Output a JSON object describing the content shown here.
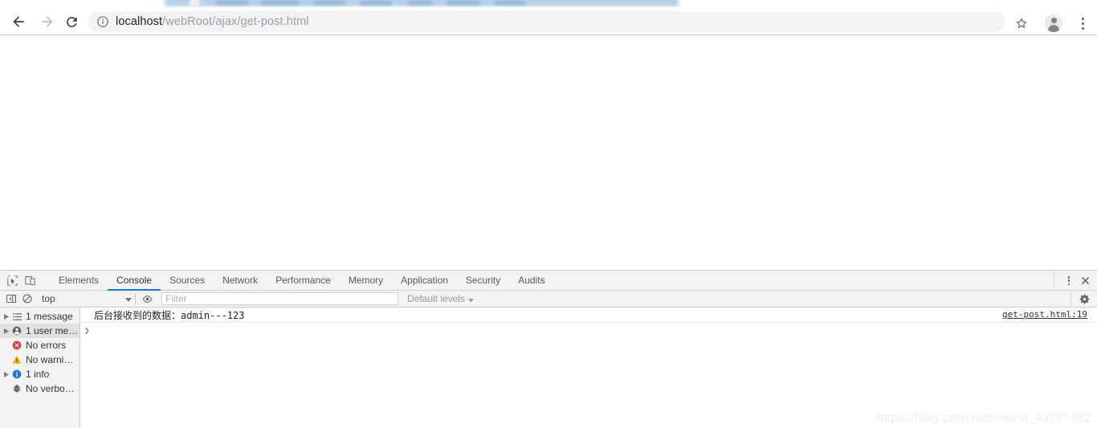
{
  "browser": {
    "nav": {
      "back_label": "Back",
      "forward_label": "Forward",
      "reload_label": "Reload"
    },
    "omnibox": {
      "host": "localhost",
      "path": "/webRoot/ajax/get-post.html",
      "full_url": "localhost/webRoot/ajax/get-post.html",
      "security_icon": "info-circle-icon"
    },
    "actions": {
      "bookmark_label": "Bookmark this page",
      "profile_label": "Profile",
      "menu_label": "Customize and control Google Chrome"
    }
  },
  "devtools": {
    "tools": {
      "inspect_label": "Inspect element",
      "device_label": "Toggle device toolbar",
      "more_label": "More options",
      "close_label": "Close DevTools"
    },
    "tabs": [
      {
        "label": "Elements",
        "active": false
      },
      {
        "label": "Console",
        "active": true
      },
      {
        "label": "Sources",
        "active": false
      },
      {
        "label": "Network",
        "active": false
      },
      {
        "label": "Performance",
        "active": false
      },
      {
        "label": "Memory",
        "active": false
      },
      {
        "label": "Application",
        "active": false
      },
      {
        "label": "Security",
        "active": false
      },
      {
        "label": "Audits",
        "active": false
      }
    ],
    "filterbar": {
      "sidebar_toggle_label": "Toggle console sidebar",
      "clear_label": "Clear console",
      "context": "top",
      "eye_label": "Live expressions",
      "filter_value": "",
      "filter_placeholder": "Filter",
      "levels_label": "Default levels",
      "settings_label": "Console settings"
    },
    "sidebar": [
      {
        "label": "1 message",
        "icon": "list-icon",
        "expandable": true,
        "selected": false
      },
      {
        "label": "1 user me…",
        "icon": "user-message-icon",
        "expandable": true,
        "selected": true
      },
      {
        "label": "No errors",
        "icon": "error-icon",
        "expandable": false,
        "selected": false
      },
      {
        "label": "No warni…",
        "icon": "warning-icon",
        "expandable": false,
        "selected": false
      },
      {
        "label": "1 info",
        "icon": "info-icon",
        "expandable": true,
        "selected": false
      },
      {
        "label": "No verbo…",
        "icon": "verbose-bug-icon",
        "expandable": false,
        "selected": false
      }
    ],
    "console": {
      "messages": [
        {
          "text": "后台接收到的数据：admin---123",
          "source": "get-post.html:19"
        }
      ],
      "prompt_symbol": "❯"
    }
  },
  "watermark": "https://blog.csdn.net/weixin_43797492",
  "colors": {
    "accent_blue": "#1a73e8",
    "error_red": "#e53935",
    "warning_yellow": "#f5b400",
    "info_blue": "#1a73e8",
    "toolbar_bg": "#f3f3f3",
    "omnibox_bg": "#f1f3f4"
  }
}
